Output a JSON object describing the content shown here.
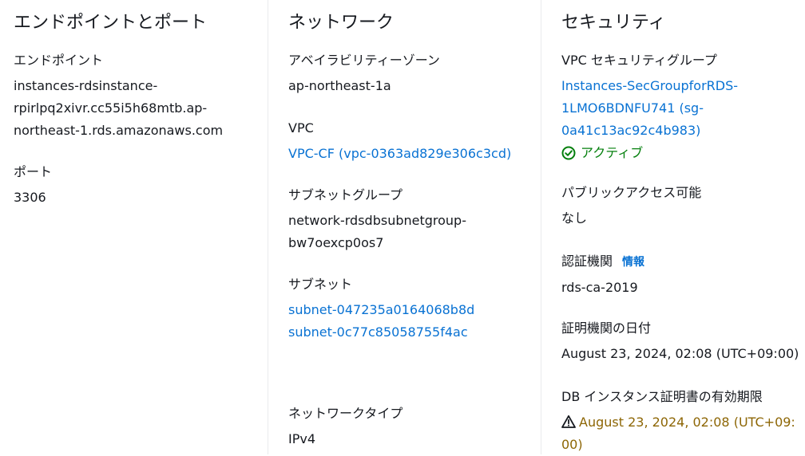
{
  "sections": {
    "endpoint_port": {
      "title": "エンドポイントとポート",
      "endpoint_label": "エンドポイント",
      "endpoint_lines": [
        "instances-rdsinstance-",
        "rpirlpq2xivr.cc55i5h68mtb.ap-",
        "northeast-1.rds.amazonaws.com"
      ],
      "port_label": "ポート",
      "port_value": "3306"
    },
    "network": {
      "title": "ネットワーク",
      "az_label": "アベイラビリティーゾーン",
      "az_value": "ap-northeast-1a",
      "vpc_label": "VPC",
      "vpc_value": "VPC-CF (vpc-0363ad829e306c3cd)",
      "subnet_group_label": "サブネットグループ",
      "subnet_group_lines": [
        "network-rdsdbsubnetgroup-",
        "bw7oexcp0os7"
      ],
      "subnets_label": "サブネット",
      "subnets": [
        "subnet-047235a0164068b8d",
        "subnet-0c77c85058755f4ac"
      ],
      "network_type_label": "ネットワークタイプ",
      "network_type_value": "IPv4"
    },
    "security": {
      "title": "セキュリティ",
      "sg_label": "VPC セキュリティグループ",
      "sg_lines": [
        "Instances-SecGroupforRDS-",
        "1LMO6BDNFU741 (sg-",
        "0a41c13ac92c4b983)"
      ],
      "sg_status": "アクティブ",
      "public_access_label": "パブリックアクセス可能",
      "public_access_value": "なし",
      "ca_label": "認証機関",
      "ca_info": "情報",
      "ca_value": "rds-ca-2019",
      "ca_date_label": "証明機関の日付",
      "ca_date_value": "August 23, 2024, 02:08 (UTC+09:00)",
      "db_cert_label": "DB インスタンス証明書の有効期限",
      "db_cert_lines": [
        "August 23, 2024, 02:08 (UTC+09:",
        "00)"
      ]
    }
  },
  "colors": {
    "link": "#0972d3",
    "success": "#037f0c",
    "warning": "#8d6605",
    "text": "#16191f",
    "divider": "#e9ebed"
  },
  "icons": {
    "status_ok": "check-circle-icon",
    "status_warn": "warning-triangle-icon"
  }
}
